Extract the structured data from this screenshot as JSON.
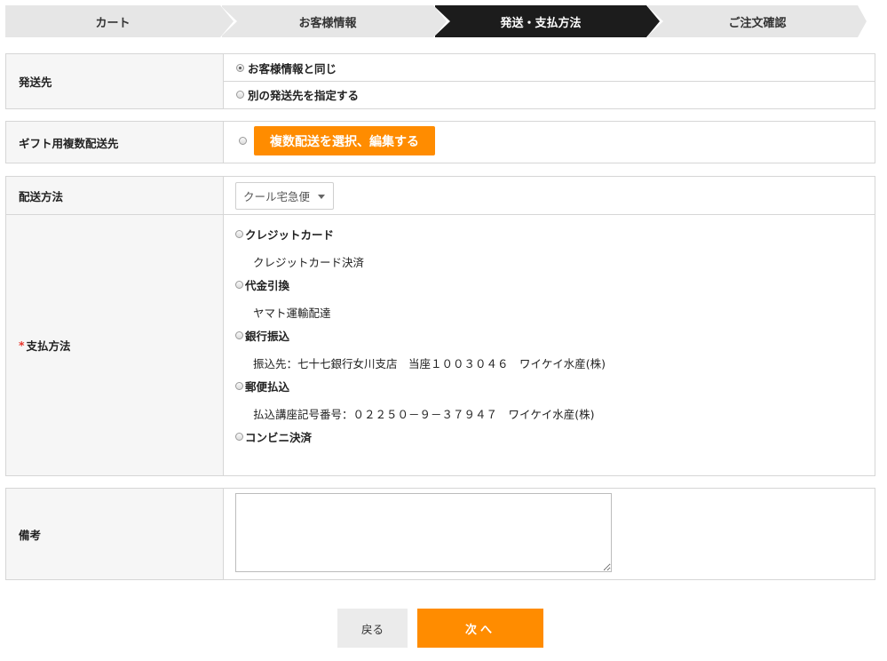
{
  "steps": [
    {
      "label": "カート",
      "active": false
    },
    {
      "label": "お客様情報",
      "active": false
    },
    {
      "label": "発送・支払方法",
      "active": true
    },
    {
      "label": "ご注文確認",
      "active": false
    }
  ],
  "shipping_dest": {
    "label": "発送先",
    "options": [
      {
        "label": "お客様情報と同じ",
        "checked": true
      },
      {
        "label": "別の発送先を指定する",
        "checked": false
      }
    ]
  },
  "gift": {
    "label": "ギフト用複数配送先",
    "button_label": "複数配送を選択、編集する",
    "checked": false
  },
  "delivery": {
    "label": "配送方法",
    "selected": "クール宅急便"
  },
  "payment": {
    "required_mark": "*",
    "label": "支払方法",
    "options": [
      {
        "label": "クレジットカード",
        "desc": "クレジットカード決済"
      },
      {
        "label": "代金引換",
        "desc": "ヤマト運輸配達"
      },
      {
        "label": "銀行振込",
        "desc": "振込先：七十七銀行女川支店　当座１００３０４６　ワイケイ水産(株)"
      },
      {
        "label": "郵便払込",
        "desc": "払込講座記号番号：０２２５０－９－３７９４７　ワイケイ水産(株)"
      },
      {
        "label": "コンビニ決済",
        "desc": ""
      }
    ]
  },
  "remarks": {
    "label": "備考",
    "value": ""
  },
  "buttons": {
    "back_label": "戻る",
    "next_label": "次へ"
  },
  "colors": {
    "accent": "#ff8c00",
    "active_step": "#1c1c1c",
    "required": "#e8352b"
  }
}
